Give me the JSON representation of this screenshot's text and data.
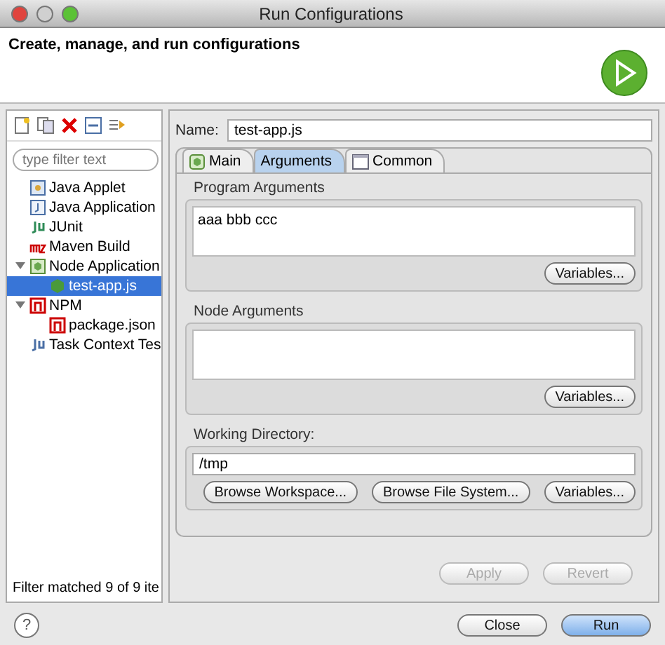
{
  "window": {
    "title": "Run Configurations"
  },
  "header": {
    "title": "Create, manage, and run configurations"
  },
  "sidebar": {
    "filter": {
      "placeholder": "type filter text"
    },
    "tree": [
      {
        "label": "Java Applet",
        "kind": "applet",
        "selected": false
      },
      {
        "label": "Java Application",
        "kind": "java",
        "selected": false
      },
      {
        "label": "JUnit",
        "kind": "junit",
        "selected": false
      },
      {
        "label": "Maven Build",
        "kind": "maven",
        "selected": false
      },
      {
        "label": "Node Application",
        "kind": "node",
        "selected": false,
        "expanded": true,
        "children": [
          {
            "label": "test-app.js",
            "kind": "nodefile",
            "selected": true
          }
        ]
      },
      {
        "label": "NPM",
        "kind": "npm",
        "selected": false,
        "expanded": true,
        "children": [
          {
            "label": "package.json",
            "kind": "npm",
            "selected": false
          }
        ]
      },
      {
        "label": "Task Context Tes",
        "kind": "task",
        "selected": false
      }
    ],
    "status": "Filter matched 9 of 9 ite"
  },
  "name": {
    "label": "Name:",
    "value": "test-app.js"
  },
  "tabs": [
    {
      "label": "Main",
      "kind": "node",
      "selected": false
    },
    {
      "label": "Arguments",
      "kind": "none",
      "selected": true
    },
    {
      "label": "Common",
      "kind": "common",
      "selected": false
    }
  ],
  "program_arguments": {
    "label": "Program Arguments",
    "value": "aaa bbb ccc",
    "button": "Variables..."
  },
  "node_arguments": {
    "label": "Node Arguments",
    "button": "Variables..."
  },
  "working_directory": {
    "label": "Working Directory:",
    "value": "/tmp",
    "buttons": [
      "Browse Workspace...",
      "Browse File System...",
      "Variables..."
    ]
  },
  "actions": [
    {
      "label": "Apply",
      "disabled": true
    },
    {
      "label": "Revert",
      "disabled": true
    }
  ],
  "footer": {
    "help": "?",
    "buttons": [
      {
        "label": "Close",
        "default": false
      },
      {
        "label": "Run",
        "default": true
      }
    ]
  }
}
